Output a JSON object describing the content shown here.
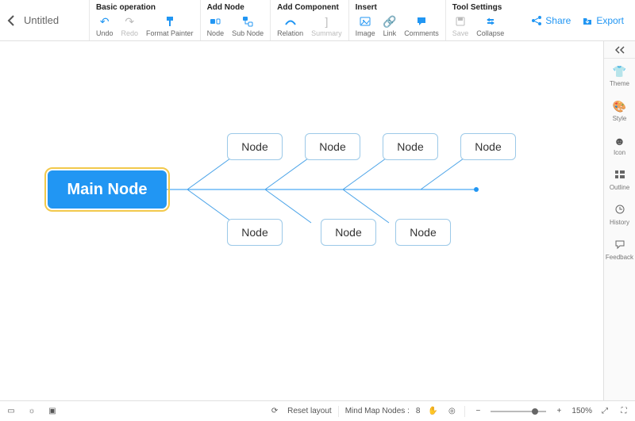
{
  "header": {
    "doc_title": "Untitled",
    "share": "Share",
    "export": "Export"
  },
  "groups": {
    "basic": {
      "title": "Basic operation",
      "undo": "Undo",
      "redo": "Redo",
      "format_painter": "Format Painter"
    },
    "add_node": {
      "title": "Add Node",
      "node": "Node",
      "sub_node": "Sub Node"
    },
    "add_component": {
      "title": "Add Component",
      "relation": "Relation",
      "summary": "Summary"
    },
    "insert": {
      "title": "Insert",
      "image": "Image",
      "link": "Link",
      "comments": "Comments"
    },
    "tool_settings": {
      "title": "Tool Settings",
      "save": "Save",
      "collapse": "Collapse"
    }
  },
  "right_panel": {
    "theme": "Theme",
    "style": "Style",
    "icon": "Icon",
    "outline": "Outline",
    "history": "History",
    "feedback": "Feedback"
  },
  "mindmap": {
    "main": "Main Node",
    "children": {
      "t1": "Node",
      "t2": "Node",
      "t3": "Node",
      "t4": "Node",
      "b1": "Node",
      "b2": "Node",
      "b3": "Node"
    }
  },
  "bottom": {
    "reset_layout": "Reset layout",
    "nodes_label": "Mind Map Nodes :",
    "nodes_count": "8",
    "zoom": "150%"
  }
}
